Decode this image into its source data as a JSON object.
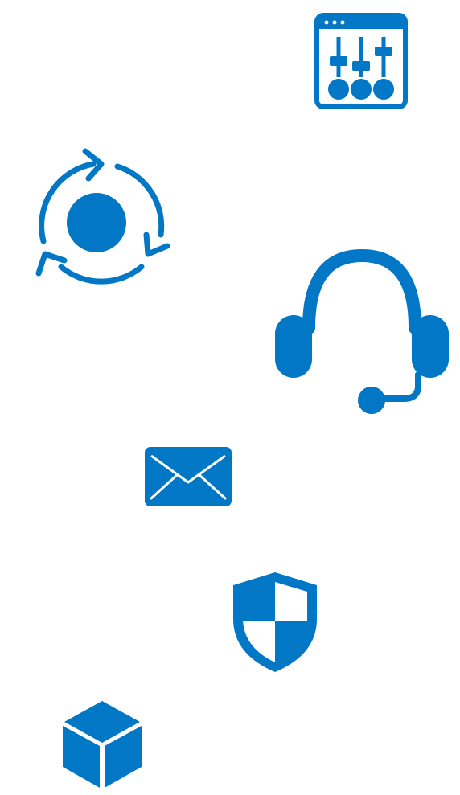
{
  "colors": {
    "icon": "#0277c5",
    "background": "#ffffff"
  },
  "icons": [
    {
      "key": "settings",
      "name": "settings-panel-icon"
    },
    {
      "key": "refresh",
      "name": "process-cycle-icon"
    },
    {
      "key": "headset",
      "name": "headset-support-icon"
    },
    {
      "key": "mail",
      "name": "mail-envelope-icon"
    },
    {
      "key": "shield",
      "name": "security-shield-icon"
    },
    {
      "key": "box",
      "name": "package-box-icon"
    }
  ]
}
